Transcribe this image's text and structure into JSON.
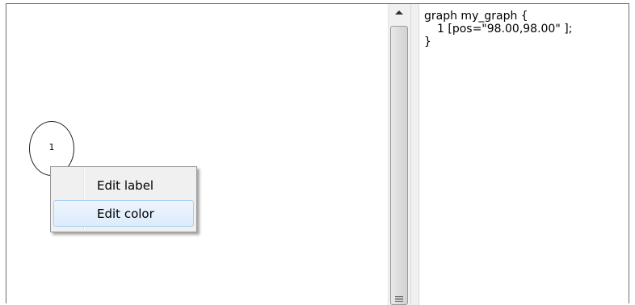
{
  "graph_canvas": {
    "node": {
      "label": "1"
    }
  },
  "context_menu": {
    "items": [
      {
        "label": "Edit label"
      },
      {
        "label": "Edit color"
      }
    ],
    "highlighted_item": "Edit color"
  },
  "source_editor": {
    "lines": [
      "graph my_graph {",
      "1 [pos=\"98.00,98.00\" ];",
      "}"
    ]
  },
  "icons": {
    "scroll_up": "chevron-up-icon",
    "scroll_grip": "grip-icon"
  }
}
